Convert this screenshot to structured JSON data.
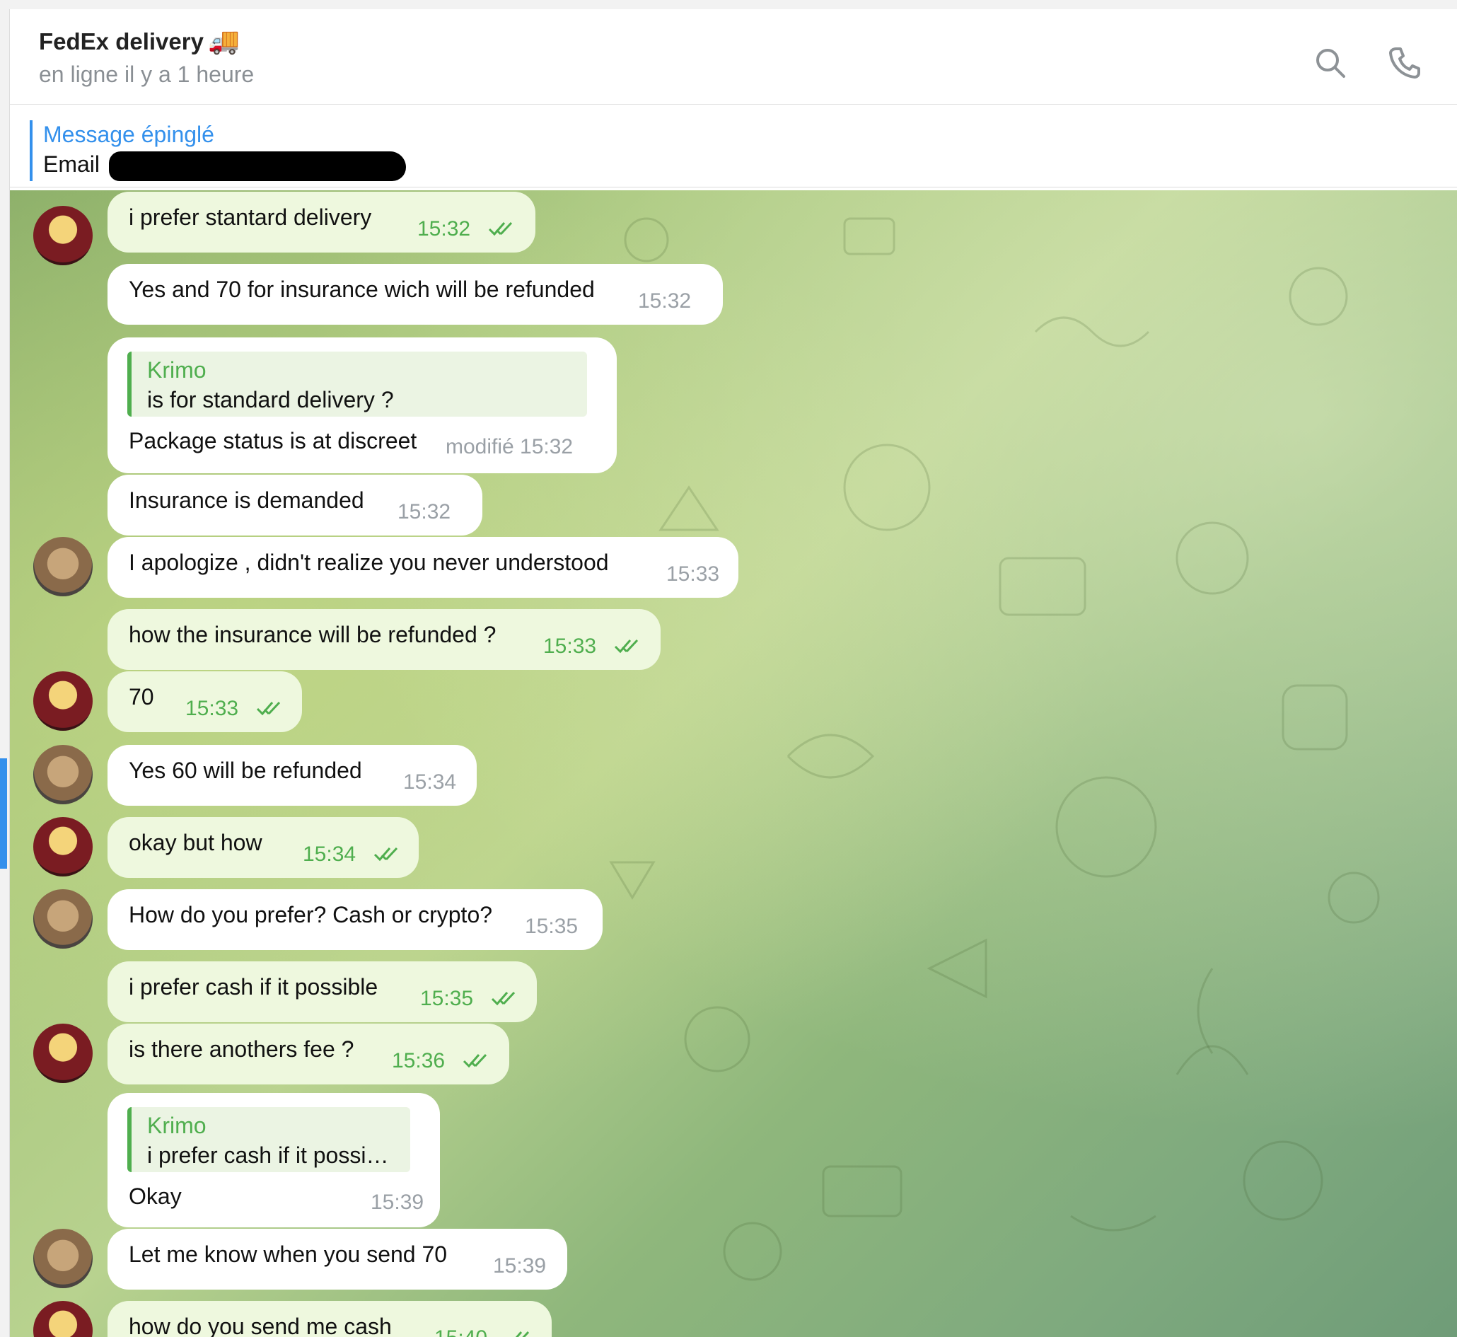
{
  "header": {
    "title": "FedEx delivery",
    "title_emoji": "🚚",
    "status": "en ligne il y a 1 heure",
    "icons": [
      "search-icon",
      "phone-icon"
    ]
  },
  "pinned": {
    "label": "Message épinglé",
    "text": "Email"
  },
  "colors": {
    "accent": "#3390ec",
    "outgoing_bubble": "#eef8de",
    "outgoing_time": "#4fae4e",
    "incoming_bubble": "#ffffff"
  },
  "messages": [
    {
      "text": "i prefer stantard delivery",
      "time": "15:32",
      "dir": "out"
    },
    {
      "text": "Yes and 70 for insurance wich will be refunded",
      "time": "15:32",
      "dir": "in"
    },
    {
      "reply_name": "Krimo",
      "reply_text": "is for standard delivery ?",
      "text": "Package status is at discreet",
      "time": "modifié 15:32",
      "dir": "in"
    },
    {
      "text": "Insurance is demanded",
      "time": "15:32",
      "dir": "in"
    },
    {
      "text": "I apologize , didn't realize you never understood",
      "time": "15:33",
      "dir": "in"
    },
    {
      "text": "how the insurance will be refunded ?",
      "time": "15:33",
      "dir": "out"
    },
    {
      "text": "70",
      "time": "15:33",
      "dir": "out"
    },
    {
      "text": "Yes 60 will be refunded",
      "time": "15:34",
      "dir": "in"
    },
    {
      "text": "okay but how",
      "time": "15:34",
      "dir": "out"
    },
    {
      "text": "How do you prefer? Cash or crypto?",
      "time": "15:35",
      "dir": "in"
    },
    {
      "text": "i prefer cash if it possible",
      "time": "15:35",
      "dir": "out"
    },
    {
      "text": "is there anothers fee ?",
      "time": "15:36",
      "dir": "out"
    },
    {
      "reply_name": "Krimo",
      "reply_text": "i prefer cash if it possi…",
      "text": "Okay",
      "time": "15:39",
      "dir": "in"
    },
    {
      "text": "Let me know when you send 70",
      "time": "15:39",
      "dir": "in"
    },
    {
      "text": "how do you send me cash",
      "time": "15:40",
      "dir": "out"
    }
  ]
}
